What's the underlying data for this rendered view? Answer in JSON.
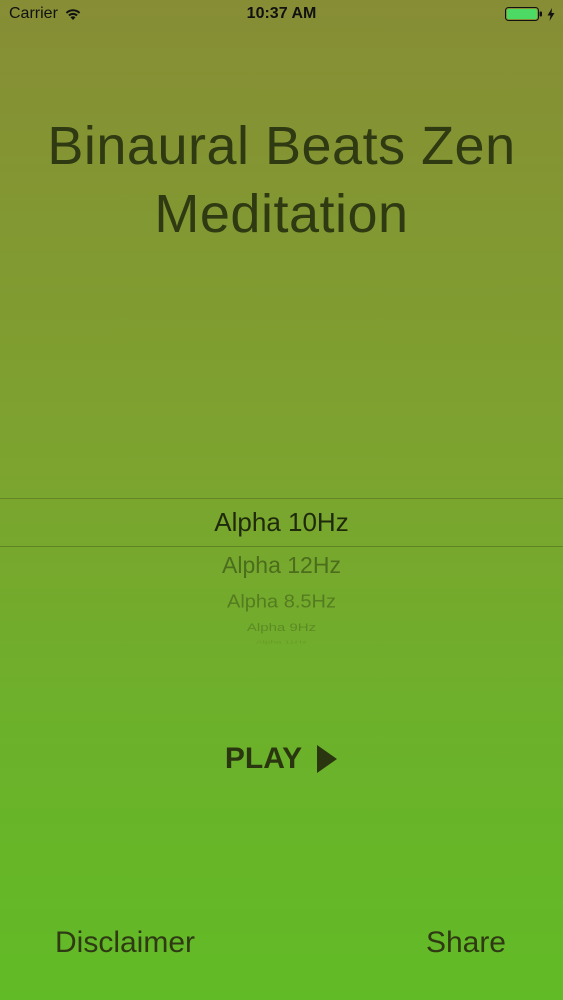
{
  "status_bar": {
    "carrier": "Carrier",
    "time": "10:37 AM",
    "battery_color": "#4cd964"
  },
  "title": "Binaural Beats Zen Meditation",
  "picker": {
    "selected": "Alpha 10Hz",
    "items": [
      "Alpha 10Hz",
      "Alpha 12Hz",
      "Alpha 8.5Hz",
      "Alpha 9Hz",
      "Alpha 11Hz"
    ]
  },
  "play_button": {
    "label": "PLAY"
  },
  "footer": {
    "disclaimer_label": "Disclaimer",
    "share_label": "Share"
  },
  "colors": {
    "background_top": "#878d35",
    "background_bottom": "#61bb26",
    "text": "#2e3a12"
  }
}
